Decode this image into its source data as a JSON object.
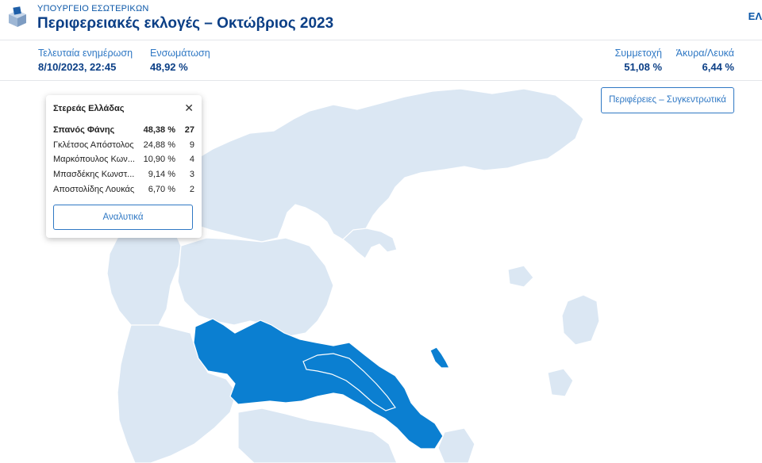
{
  "header": {
    "ministry": "ΥΠΟΥΡΓΕΙΟ ΕΣΩΤΕΡΙΚΩΝ",
    "title": "Περιφερειακές εκλογές – Οκτώβριος 2023",
    "lang": "ΕΛ",
    "logo_icon": "ballot-box-icon"
  },
  "stats": {
    "last_update_label": "Τελευταία ενημέρωση",
    "last_update_value": "8/10/2023, 22:45",
    "integration_label": "Ενσωμάτωση",
    "integration_value": "48,92 %",
    "turnout_label": "Συμμετοχή",
    "turnout_value": "51,08 %",
    "invalid_label": "Άκυρα/Λευκά",
    "invalid_value": "6,44 %"
  },
  "regions_button": "Περιφέρειες – Συγκεντρωτικά",
  "popup": {
    "title": "Στερεάς Ελλάδας",
    "close_icon": "close-icon",
    "candidates": [
      {
        "name": "Σπανός Φάνης",
        "percent": "48,38 %",
        "seats": "27"
      },
      {
        "name": "Γκλέτσος Απόστολος",
        "percent": "24,88 %",
        "seats": "9"
      },
      {
        "name": "Μαρκόπουλος Κων...",
        "percent": "10,90 %",
        "seats": "4"
      },
      {
        "name": "Μπασδέκης Κωνστ...",
        "percent": "9,14 %",
        "seats": "3"
      },
      {
        "name": "Αποστολίδης Λουκάς",
        "percent": "6,70 %",
        "seats": "2"
      }
    ],
    "details_button": "Αναλυτικά"
  },
  "colors": {
    "selected_region": "#0b7fd1",
    "other_region": "#dbe7f3",
    "accent": "#2f78c4",
    "title": "#0b3f86"
  }
}
